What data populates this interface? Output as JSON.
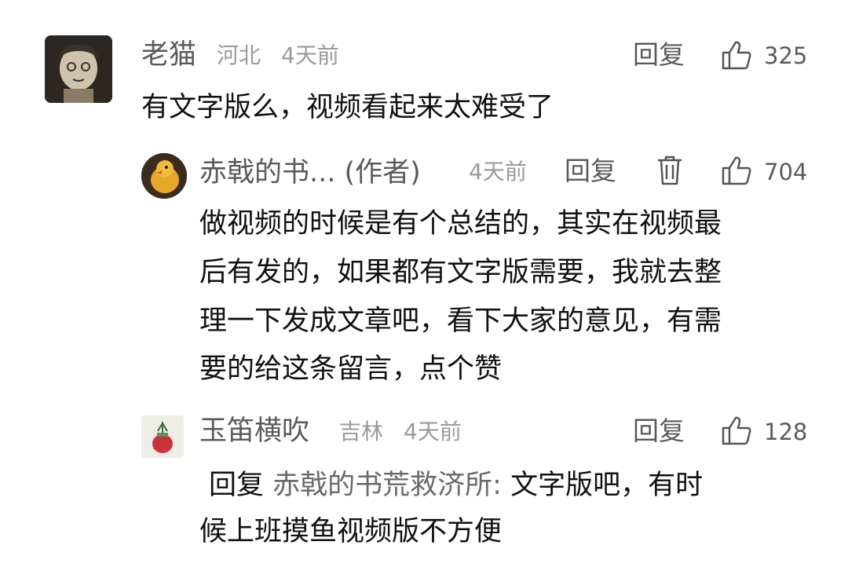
{
  "comments": [
    {
      "user": "老猫",
      "region": "河北",
      "time": "4天前",
      "reply_label": "回复",
      "likes": "325",
      "text": "有文字版么，视频看起来太难受了"
    },
    {
      "user": "赤戟的书... (作者)",
      "time": "4天前",
      "reply_label": "回复",
      "likes": "704",
      "text_lines": [
        "做视频的时候是有个总结的，其实在视频最",
        "后有发的，如果都有文字版需要，我就去整",
        "理一下发成文章吧，看下大家的意见，有需",
        "要的给这条留言，点个赞"
      ]
    },
    {
      "user": "玉笛横吹",
      "region": "吉林",
      "time": "4天前",
      "reply_label": "回复",
      "likes": "128",
      "reply_prefix": "回复",
      "mention": "赤戟的书荒救济所:",
      "text_line1": "文字版吧，有时",
      "text_line2": "候上班摸鱼视频版不方便"
    }
  ],
  "colors": {
    "text": "#111111",
    "secondary": "#5a5a5a",
    "meta": "#9a9a9a"
  },
  "icons": [
    "like-icon",
    "trash-icon"
  ]
}
